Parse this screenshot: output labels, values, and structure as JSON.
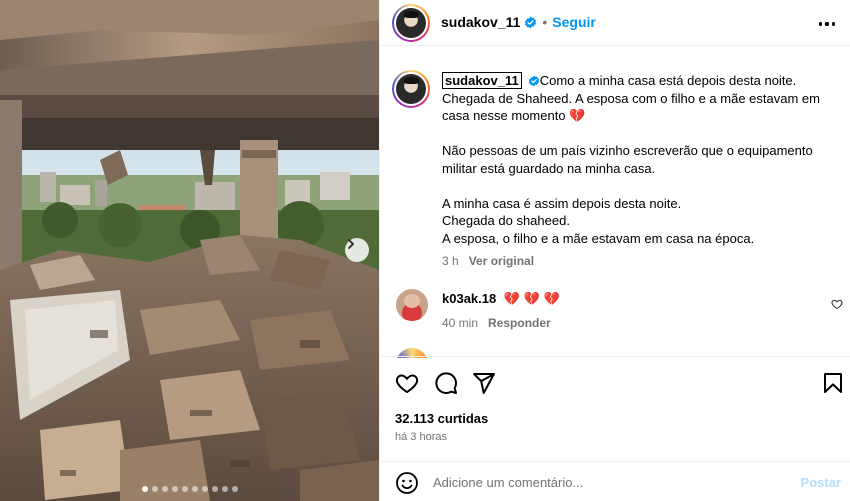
{
  "post": {
    "username": "sudakov_11",
    "follow_label": "Seguir",
    "separator": "•",
    "caption_lines": [
      "Como a minha casa está depois desta noite. Chegada de Shaheed. A esposa com o filho e a mãe estavam em casa nesse momento 💔",
      "Não pessoas de um país vizinho escreverão que o equipamento militar está guardado na minha casa.",
      "A minha casa é assim depois desta noite.",
      "Chegada do shaheed.",
      "A esposa, o filho e a mãe estavam em casa na época."
    ],
    "caption_time": "3 h",
    "see_translation": "Ver original",
    "likes": "32.113 curtidas",
    "posted_ago": "há 3 horas"
  },
  "comments": [
    {
      "username": "k03ak.18",
      "text": "💔 💔 💔",
      "time": "40 min",
      "reply_label": "Responder"
    }
  ],
  "add_comment": {
    "placeholder": "Adicione um comentário...",
    "post_label": "Postar"
  },
  "carousel": {
    "total": 10,
    "active_index": 0
  },
  "colors": {
    "accent": "#0095f6",
    "muted": "#737373",
    "border": "#efefef",
    "post_disabled": "#b3dffc"
  },
  "icons": [
    "verified-icon",
    "more-icon",
    "heart-icon",
    "comment-icon",
    "share-icon",
    "bookmark-icon",
    "emoji-icon",
    "chevron-right-icon"
  ]
}
